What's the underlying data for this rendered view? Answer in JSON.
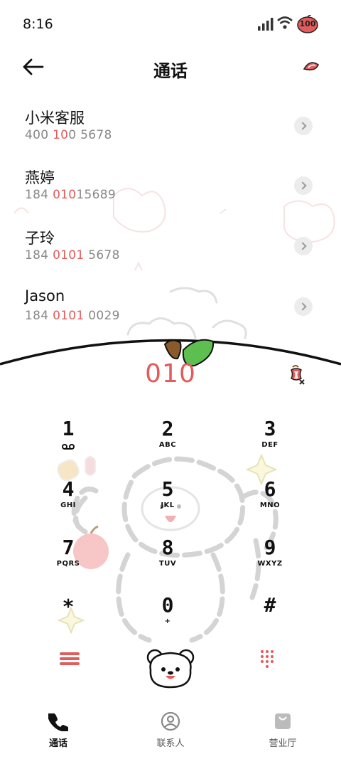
{
  "status": {
    "time": "8:16",
    "battery": "100"
  },
  "header": {
    "title": "通话"
  },
  "contacts": [
    {
      "name": "小米客服",
      "num_parts": [
        "400 ",
        "10",
        "0 5678"
      ]
    },
    {
      "name": "燕婷",
      "num_parts": [
        "184 ",
        "010",
        "15689"
      ]
    },
    {
      "name": "子玲",
      "num_parts": [
        "184 ",
        "0101",
        " 5678"
      ]
    },
    {
      "name": "Jason",
      "num_parts": [
        "184 ",
        "0101",
        " 0029"
      ]
    }
  ],
  "dialer": {
    "input": "010",
    "keys": [
      {
        "digit": "1",
        "letters": ""
      },
      {
        "digit": "2",
        "letters": "ABC"
      },
      {
        "digit": "3",
        "letters": "DEF"
      },
      {
        "digit": "4",
        "letters": "GHI"
      },
      {
        "digit": "5",
        "letters": "JKL"
      },
      {
        "digit": "6",
        "letters": "MNO"
      },
      {
        "digit": "7",
        "letters": "PQRS"
      },
      {
        "digit": "8",
        "letters": "TUV"
      },
      {
        "digit": "9",
        "letters": "WXYZ"
      },
      {
        "digit": "*",
        "letters": ""
      },
      {
        "digit": "0",
        "letters": "+"
      },
      {
        "digit": "#",
        "letters": ""
      }
    ]
  },
  "tabs": [
    {
      "label": "通话",
      "icon": "phone-icon"
    },
    {
      "label": "联系人",
      "icon": "contacts-icon"
    },
    {
      "label": "营业厅",
      "icon": "store-icon"
    }
  ],
  "colors": {
    "accent": "#e45b5b",
    "leaf": "#5cbf4f",
    "chevron_bg": "#ececec"
  }
}
